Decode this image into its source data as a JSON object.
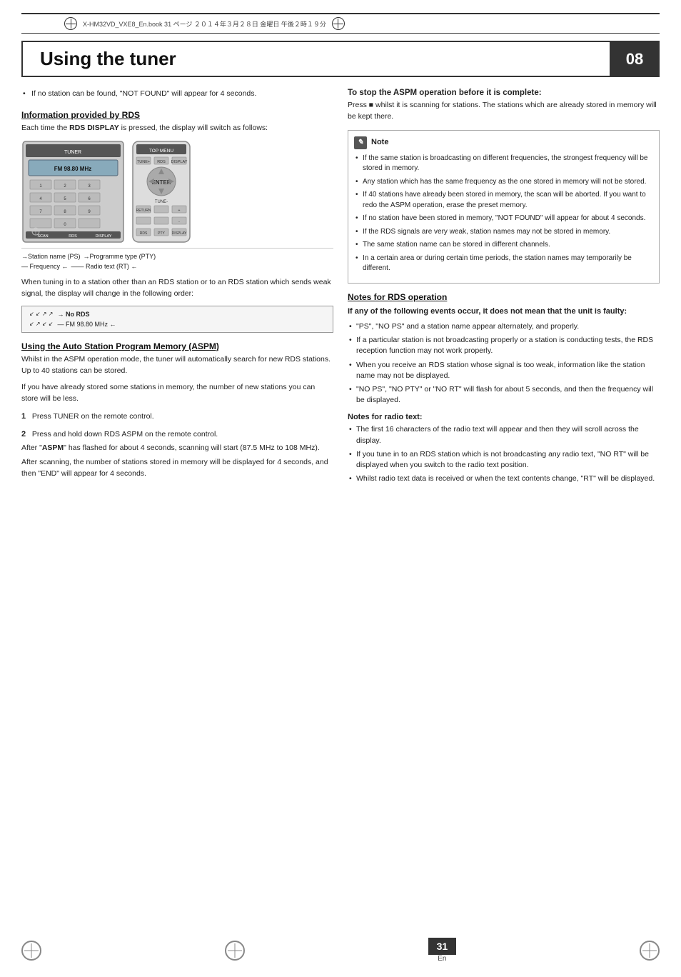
{
  "print_header": {
    "text": "X-HM32VD_VXE8_En.book  31 ページ  ２０１４年３月２８日  金曜日  午後２時１９分"
  },
  "page": {
    "title": "Using the tuner",
    "chapter": "08",
    "page_number": "31",
    "page_lang": "En"
  },
  "left": {
    "top_bullet": "If no station can be found, \"NOT FOUND\" will appear for 4 seconds.",
    "rds_section": {
      "heading": "Information provided by RDS",
      "intro": "Each time the RDS DISPLAY is pressed, the display will switch as follows:",
      "caption_lines": [
        "→Station name (PS)  →Programme type (PTY)",
        "— Frequency ←———— Radio text (RT) ←"
      ]
    },
    "tuning_note": "When tuning in to a station other than an RDS station or to an RDS station which sends weak signal, the display will change in the following order:",
    "no_rds_labels": [
      "→ No RDS",
      "— FM 98.80 MHz ←"
    ],
    "aspm_section": {
      "heading": "Using the Auto Station Program Memory (ASPM)",
      "intro": "Whilst in the ASPM operation mode, the tuner will automatically search for new RDS stations. Up to 40 stations can be stored.",
      "note1": "If you have already stored some stations in memory, the number of new stations you can store will be less.",
      "step1_num": "1",
      "step1_text": "Press TUNER on the remote control.",
      "step2_num": "2",
      "step2_text": "Press and hold down RDS ASPM on the remote control.",
      "step2_note1": "After \"ASPM\" has flashed for about 4 seconds, scanning will start (87.5 MHz to 108 MHz).",
      "step2_note2": "After scanning, the number of stations stored in memory will be displayed for 4 seconds, and then \"END\" will appear for 4 seconds."
    }
  },
  "right": {
    "stop_heading": "To stop the ASPM operation before it is complete:",
    "stop_text": "Press ■ whilst it is scanning for stations. The stations which are already stored in memory will be kept there.",
    "note_title": "Note",
    "note_bullets": [
      "If the same station is broadcasting on different frequencies, the strongest frequency will be stored in memory.",
      "Any station which has the same frequency as the one stored in memory will not be stored.",
      "If 40 stations have already been stored in memory, the scan will be aborted. If you want to redo the ASPM operation, erase the preset memory.",
      "If no station have been stored in memory, \"NOT FOUND\" will appear for about 4 seconds.",
      "If the RDS signals are very weak, station names may not be stored in memory.",
      "The same station name can be stored in different channels.",
      "In a certain area or during certain time periods, the station names may temporarily be different."
    ],
    "rds_operation_heading": "Notes for RDS operation",
    "if_any_heading": "If any of the following events occur, it does not mean that the unit is faulty:",
    "faulty_bullets": [
      "\"PS\", \"NO PS\" and a station name appear alternately, and properly.",
      "If a particular station is not broadcasting properly or a station is conducting tests, the RDS reception function may not work properly.",
      "When you receive an RDS station whose signal is too weak, information like the station name may not be displayed.",
      "\"NO PS\", \"NO PTY\" or \"NO RT\" will flash for about 5 seconds, and then the frequency will be displayed."
    ],
    "radio_text_heading": "Notes for radio text:",
    "radio_text_bullets": [
      "The first 16 characters of the radio text will appear and then they will scroll across the display.",
      "If you tune in to an RDS station which is not broadcasting any radio text, \"NO RT\" will be displayed when you switch to the radio text position.",
      "Whilst radio text data is received or when the text contents change, \"RT\" will be displayed."
    ]
  }
}
